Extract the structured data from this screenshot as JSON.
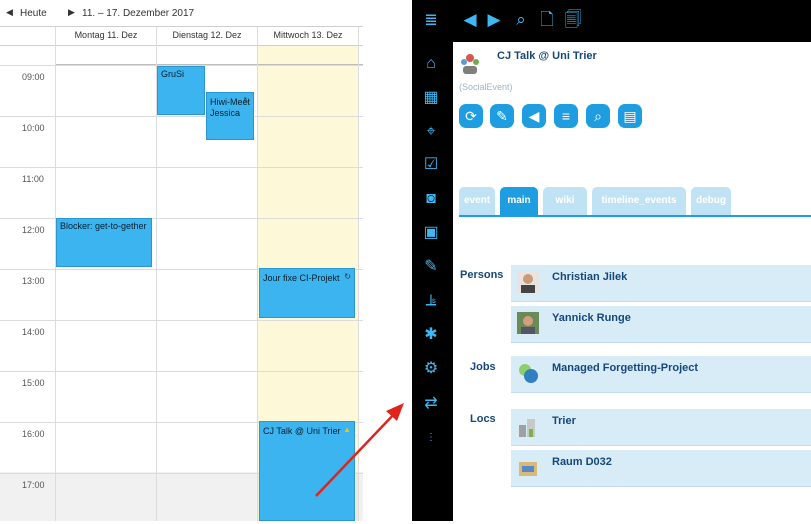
{
  "calendar": {
    "today_label": "Heute",
    "range": "11. – 17. Dezember 2017",
    "days": [
      "Montag 11. Dez",
      "Dienstag 12. Dez",
      "Mittwoch 13. Dez"
    ],
    "hours": [
      "09:00",
      "10:00",
      "11:00",
      "12:00",
      "13:00",
      "14:00",
      "15:00",
      "16:00",
      "17:00"
    ],
    "events": {
      "grusi": "GruSi",
      "hiwi_title": "Hiwi-Meeti",
      "hiwi_sub": "Jessica",
      "blocker": "Blocker: get-to-gether",
      "jourfixe": "Jour fixe CI-Projekt",
      "cjtalk": "CJ Talk @ Uni Trier"
    }
  },
  "app": {
    "title": "CJ Talk @ Uni Trier",
    "type": "(SocialEvent)",
    "tabs": [
      "event",
      "main",
      "wiki",
      "timeline_events",
      "debug"
    ],
    "active_tab": "main",
    "sections": {
      "persons_label": "Persons",
      "jobs_label": "Jobs",
      "locs_label": "Locs"
    },
    "persons": [
      "Christian Jilek",
      "Yannick Runge"
    ],
    "jobs": [
      "Managed Forgetting-Project"
    ],
    "locs": [
      "Trier",
      "Raum D032"
    ],
    "colors": {
      "accent": "#1e9ee0",
      "title": "#16477a",
      "row": "#d8ecf8",
      "event": "#3bb4ef",
      "arrow": "#e0241b"
    }
  }
}
